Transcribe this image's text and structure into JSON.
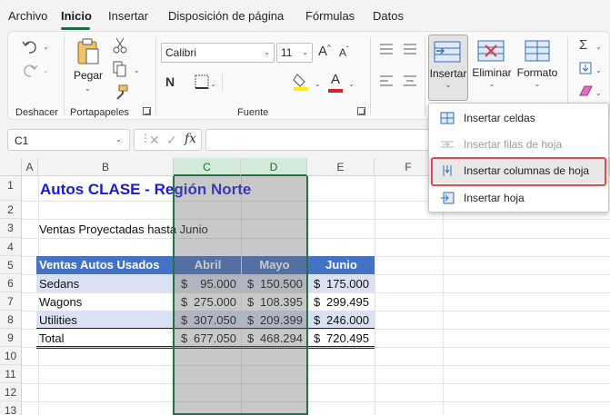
{
  "menubar": {
    "tabs": [
      "Archivo",
      "Inicio",
      "Insertar",
      "Disposición de página",
      "Fórmulas",
      "Datos"
    ],
    "active": "Inicio"
  },
  "ribbon": {
    "groups": {
      "undo": "Deshacer",
      "clipboard": "Portapapeles",
      "font": "Fuente"
    },
    "paste_label": "Pegar",
    "font_name": "Calibri",
    "font_size": "11",
    "insert_label": "Insertar",
    "delete_label": "Eliminar",
    "format_label": "Formato",
    "bold": "N",
    "font_color_letter": "A",
    "grow_font": "A",
    "shrink_font": "A",
    "font_color": "#e02020",
    "highlight_color": "#ffee00"
  },
  "formula_bar": {
    "name_box": "C1",
    "fx": "fx",
    "formula": ""
  },
  "grid": {
    "columns": [
      "A",
      "B",
      "C",
      "D",
      "E",
      "F"
    ],
    "rows": [
      "1",
      "2",
      "3",
      "4",
      "5",
      "6",
      "7",
      "8",
      "9",
      "10",
      "11",
      "12",
      "13"
    ],
    "title": "Autos CLASE - Región Norte",
    "subtitle": "Ventas Proyectadas hasta Junio",
    "table_header": [
      "Ventas Autos Usados",
      "Abril",
      "Mayo",
      "Junio"
    ],
    "table_rows": [
      {
        "label": "Sedans",
        "abril": [
          "$",
          "95.000"
        ],
        "mayo": [
          "$",
          "150.500"
        ],
        "junio": [
          "$",
          "175.000"
        ]
      },
      {
        "label": "Wagons",
        "abril": [
          "$",
          "275.000"
        ],
        "mayo": [
          "$",
          "108.395"
        ],
        "junio": [
          "$",
          "299.495"
        ]
      },
      {
        "label": "Utilities",
        "abril": [
          "$",
          "307.050"
        ],
        "mayo": [
          "$",
          "209.399"
        ],
        "junio": [
          "$",
          "246.000"
        ]
      },
      {
        "label": "Total",
        "abril": [
          "$",
          "677.050"
        ],
        "mayo": [
          "$",
          "468.294"
        ],
        "junio": [
          "$",
          "720.495"
        ]
      }
    ],
    "header_color": "#4472c4",
    "band_color": "#d9e1f2",
    "selection_color": "#217346"
  },
  "insert_menu": {
    "items": [
      {
        "label": "Insertar celdas",
        "disabled": false
      },
      {
        "label": "Insertar filas de hoja",
        "disabled": true
      },
      {
        "label": "Insertar columnas de hoja",
        "disabled": false,
        "highlighted": true
      },
      {
        "label": "Insertar hoja",
        "disabled": false
      }
    ],
    "highlight_color": "#e04b4b"
  }
}
